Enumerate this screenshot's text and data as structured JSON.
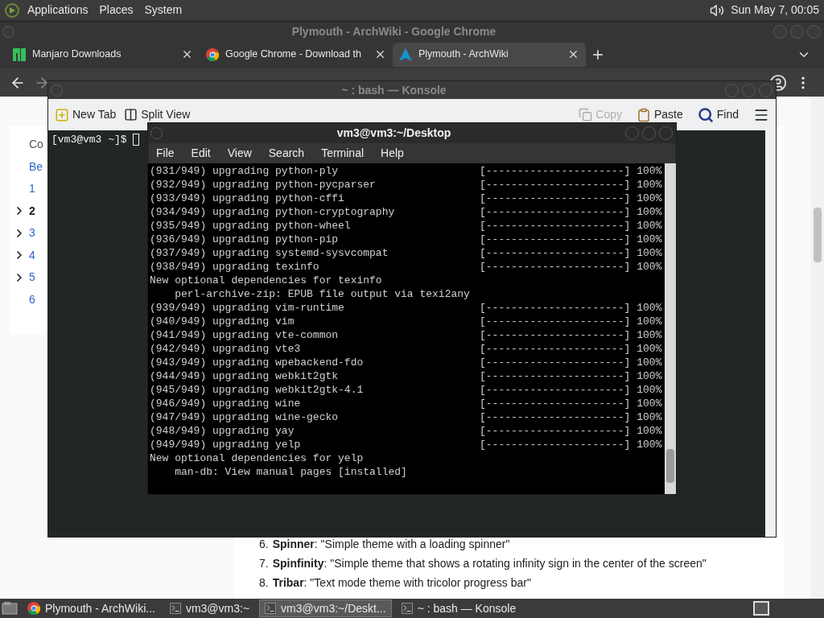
{
  "top_panel": {
    "menus": [
      "Applications",
      "Places",
      "System"
    ],
    "clock": "Sun May 7, 00:05"
  },
  "browser": {
    "title": "Plymouth - ArchWiki - Google Chrome",
    "tabs": [
      {
        "label": "Manjaro Downloads",
        "kind": "manjaro",
        "selected": false
      },
      {
        "label": "Google Chrome - Download th",
        "kind": "chrome",
        "selected": false
      },
      {
        "label": "Plymouth - ArchWiki",
        "kind": "arch",
        "selected": true
      }
    ],
    "toc": [
      {
        "label": "Co",
        "kind": "heading",
        "expandable": false,
        "selected": false
      },
      {
        "label": "Be",
        "kind": "link",
        "expandable": false,
        "selected": false
      },
      {
        "label": "1",
        "kind": "link",
        "expandable": false,
        "selected": false
      },
      {
        "label": "2",
        "kind": "link",
        "expandable": true,
        "selected": true
      },
      {
        "label": "3",
        "kind": "link",
        "expandable": true,
        "selected": false
      },
      {
        "label": "4",
        "kind": "link",
        "expandable": true,
        "selected": false
      },
      {
        "label": "5",
        "kind": "link",
        "expandable": true,
        "selected": false
      },
      {
        "label": "6",
        "kind": "link",
        "expandable": false,
        "selected": false
      }
    ],
    "list": [
      {
        "number": "6.",
        "text": "**Spinner**: \"Simple theme with a loading spinner\""
      },
      {
        "number": "7.",
        "text": "**Spinfinity**: \"Simple theme that shows a rotating infinity sign in the center of the screen\""
      },
      {
        "number": "8.",
        "text": "**Tribar**: \"Text mode theme with tricolor progress bar\""
      }
    ]
  },
  "konsole": {
    "title": "~ : bash — Konsole",
    "toolbar_left": [
      {
        "label": "New Tab",
        "kind": "new-tab"
      },
      {
        "label": "Split View",
        "kind": "split"
      }
    ],
    "toolbar_right": [
      {
        "label": "Copy",
        "kind": "copy",
        "disabled": true
      },
      {
        "label": "Paste",
        "kind": "paste",
        "disabled": false
      },
      {
        "label": "Find",
        "kind": "find",
        "disabled": false
      }
    ],
    "prompt": "[vm3@vm3 ~]$"
  },
  "terminal": {
    "title": "vm3@vm3:~/Desktop",
    "menus": [
      "File",
      "Edit",
      "View",
      "Search",
      "Terminal",
      "Help"
    ],
    "lines": [
      {
        "text": "(931/949) upgrading python-ply",
        "progress": "[----------------------]",
        "percent": "100%"
      },
      {
        "text": "(932/949) upgrading python-pycparser",
        "progress": "[----------------------]",
        "percent": "100%"
      },
      {
        "text": "(933/949) upgrading python-cffi",
        "progress": "[----------------------]",
        "percent": "100%"
      },
      {
        "text": "(934/949) upgrading python-cryptography",
        "progress": "[----------------------]",
        "percent": "100%"
      },
      {
        "text": "(935/949) upgrading python-wheel",
        "progress": "[----------------------]",
        "percent": "100%"
      },
      {
        "text": "(936/949) upgrading python-pip",
        "progress": "[----------------------]",
        "percent": "100%"
      },
      {
        "text": "(937/949) upgrading systemd-sysvcompat",
        "progress": "[----------------------]",
        "percent": "100%"
      },
      {
        "text": "(938/949) upgrading texinfo",
        "progress": "[----------------------]",
        "percent": "100%"
      },
      {
        "text": "New optional dependencies for texinfo"
      },
      {
        "text": "    perl-archive-zip: EPUB file output via texi2any"
      },
      {
        "text": "(939/949) upgrading vim-runtime",
        "progress": "[----------------------]",
        "percent": "100%"
      },
      {
        "text": "(940/949) upgrading vim",
        "progress": "[----------------------]",
        "percent": "100%"
      },
      {
        "text": "(941/949) upgrading vte-common",
        "progress": "[----------------------]",
        "percent": "100%"
      },
      {
        "text": "(942/949) upgrading vte3",
        "progress": "[----------------------]",
        "percent": "100%"
      },
      {
        "text": "(943/949) upgrading wpebackend-fdo",
        "progress": "[----------------------]",
        "percent": "100%"
      },
      {
        "text": "(944/949) upgrading webkit2gtk",
        "progress": "[----------------------]",
        "percent": "100%"
      },
      {
        "text": "(945/949) upgrading webkit2gtk-4.1",
        "progress": "[----------------------]",
        "percent": "100%"
      },
      {
        "text": "(946/949) upgrading wine",
        "progress": "[----------------------]",
        "percent": "100%"
      },
      {
        "text": "(947/949) upgrading wine-gecko",
        "progress": "[----------------------]",
        "percent": "100%"
      },
      {
        "text": "(948/949) upgrading yay",
        "progress": "[----------------------]",
        "percent": "100%"
      },
      {
        "text": "(949/949) upgrading yelp",
        "progress": "[----------------------]",
        "percent": "100%"
      },
      {
        "text": "New optional dependencies for yelp"
      },
      {
        "text": "    man-db: View manual pages [installed]"
      }
    ]
  },
  "taskbar": [
    {
      "label": "Plymouth - ArchWiki...",
      "kind": "chrome",
      "selected": false
    },
    {
      "label": "vm3@vm3:~",
      "kind": "terminal",
      "selected": false
    },
    {
      "label": "vm3@vm3:~/Deskt...",
      "kind": "terminal",
      "selected": true
    },
    {
      "label": "~ : bash — Konsole",
      "kind": "terminal",
      "selected": false
    }
  ]
}
